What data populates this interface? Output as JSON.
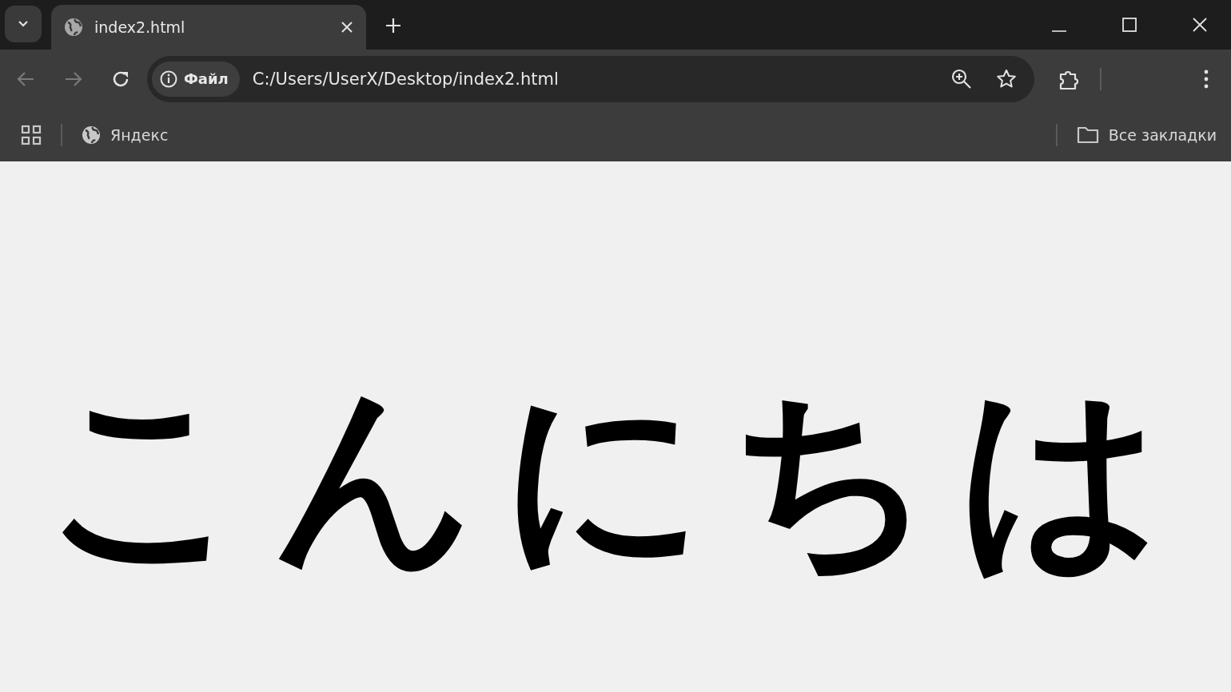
{
  "tabs": [
    {
      "title": "index2.html",
      "selected": true
    }
  ],
  "navigation": {
    "back_disabled": true,
    "forward_disabled": true
  },
  "address_bar": {
    "badge": "Файл",
    "url": "C:/Users/UserX/Desktop/index2.html"
  },
  "bookmarks": [
    {
      "label": "Яндекс"
    }
  ],
  "all_bookmarks": "Все закладки",
  "page": {
    "heading": "こんにちは"
  }
}
